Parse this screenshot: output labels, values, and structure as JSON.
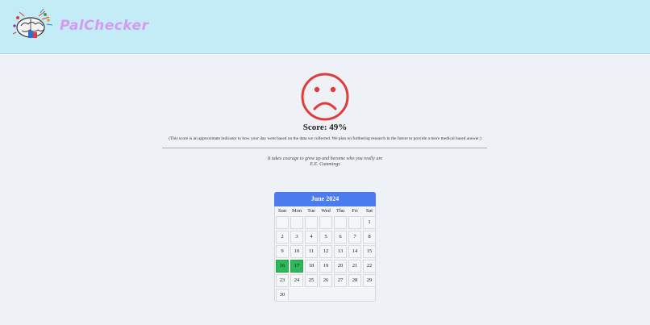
{
  "header": {
    "brand": "PalChecker",
    "logo_icon": "colorful-brain-logo",
    "background": "#c4ecf6",
    "brand_color": "#d59bf0"
  },
  "result": {
    "mood_icon": "sad-face-icon",
    "mood_color": "#e23b3b",
    "score_label": "Score: 49%",
    "score_value_percent": 49,
    "note": "(This score is an approximate indicator to how your day went based on the data we collected. We plan on furthering research in the future to provide a more medical based answer.)"
  },
  "quote": {
    "text": "It takes courage to grow up and become who you really are",
    "author": "E.E. Cummings"
  },
  "calendar": {
    "title": "June 2024",
    "header_color": "#4a7bef",
    "highlight_color": "#2fb85a",
    "day_names": [
      "Sun",
      "Mon",
      "Tue",
      "Wed",
      "Thu",
      "Fri",
      "Sat"
    ],
    "leading_blank_days": 6,
    "days": [
      "1",
      "2",
      "3",
      "4",
      "5",
      "6",
      "7",
      "8",
      "9",
      "10",
      "11",
      "12",
      "13",
      "14",
      "15",
      "16",
      "17",
      "18",
      "19",
      "20",
      "21",
      "22",
      "23",
      "24",
      "25",
      "26",
      "27",
      "28",
      "29",
      "30"
    ],
    "highlighted_days": [
      "16",
      "17"
    ]
  }
}
